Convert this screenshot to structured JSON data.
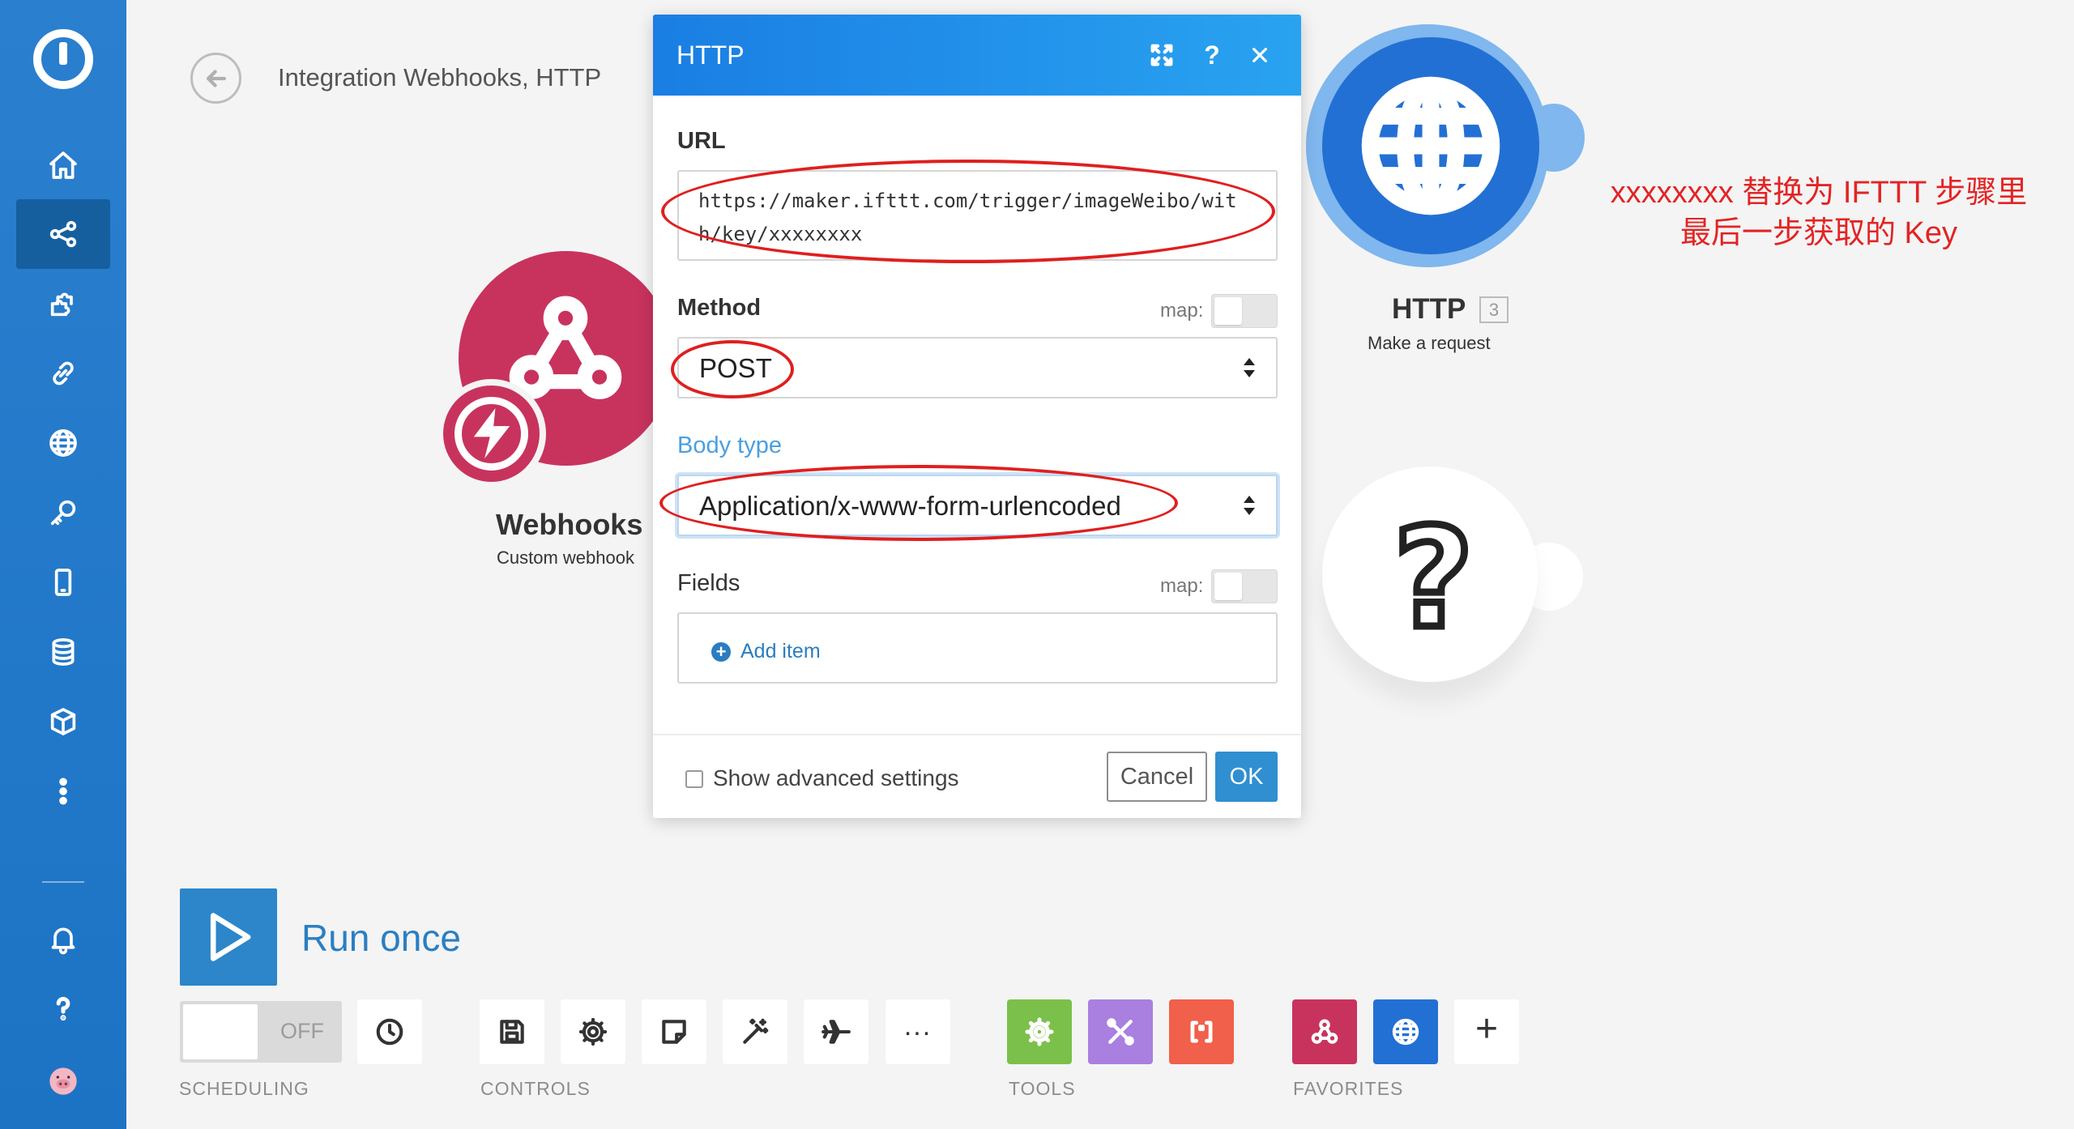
{
  "sidebar": {
    "items": [
      {
        "icon": "home-icon"
      },
      {
        "icon": "scenarios-icon",
        "active": true
      },
      {
        "icon": "templates-icon"
      },
      {
        "icon": "connections-icon"
      },
      {
        "icon": "webhooks-icon"
      },
      {
        "icon": "keys-icon"
      },
      {
        "icon": "devices-icon"
      },
      {
        "icon": "datastores-icon"
      },
      {
        "icon": "datastructures-icon"
      },
      {
        "icon": "more-icon"
      }
    ],
    "bottom": [
      {
        "icon": "notifications-icon"
      },
      {
        "icon": "help-icon"
      },
      {
        "icon": "user-avatar"
      }
    ]
  },
  "header": {
    "breadcrumb": "Integration Webhooks, HTTP"
  },
  "modules": {
    "webhooks": {
      "title": "Webhooks",
      "subtitle": "Custom webhook"
    },
    "http": {
      "title": "HTTP",
      "number": "3",
      "subtitle": "Make a request"
    }
  },
  "annotation": {
    "line1": "xxxxxxxx 替换为 IFTTT 步骤里",
    "line2": "最后一步获取的 Key",
    "color": "#e32424"
  },
  "dialog": {
    "title": "HTTP",
    "url_label": "URL",
    "url_value": "https://maker.ifttt.com/trigger/imageWeibo/with/key/xxxxxxxx",
    "method_label": "Method",
    "map_label": "map:",
    "method_value": "POST",
    "body_type_label": "Body type",
    "body_type_value": "Application/x-www-form-urlencoded",
    "fields_label": "Fields",
    "add_item_label": "Add item",
    "advanced_label": "Show advanced settings",
    "cancel_label": "Cancel",
    "ok_label": "OK"
  },
  "bottom_bar": {
    "run_once_label": "Run once",
    "scheduling_toggle": "OFF",
    "sections": {
      "scheduling": "SCHEDULING",
      "controls": "CONTROLS",
      "tools": "TOOLS",
      "favorites": "FAVORITES"
    }
  },
  "colors": {
    "sidebar": "#1c73c4",
    "accent": "#2b7fc2",
    "webhooks_module": "#c8335e",
    "http_module": "#2370d4"
  }
}
